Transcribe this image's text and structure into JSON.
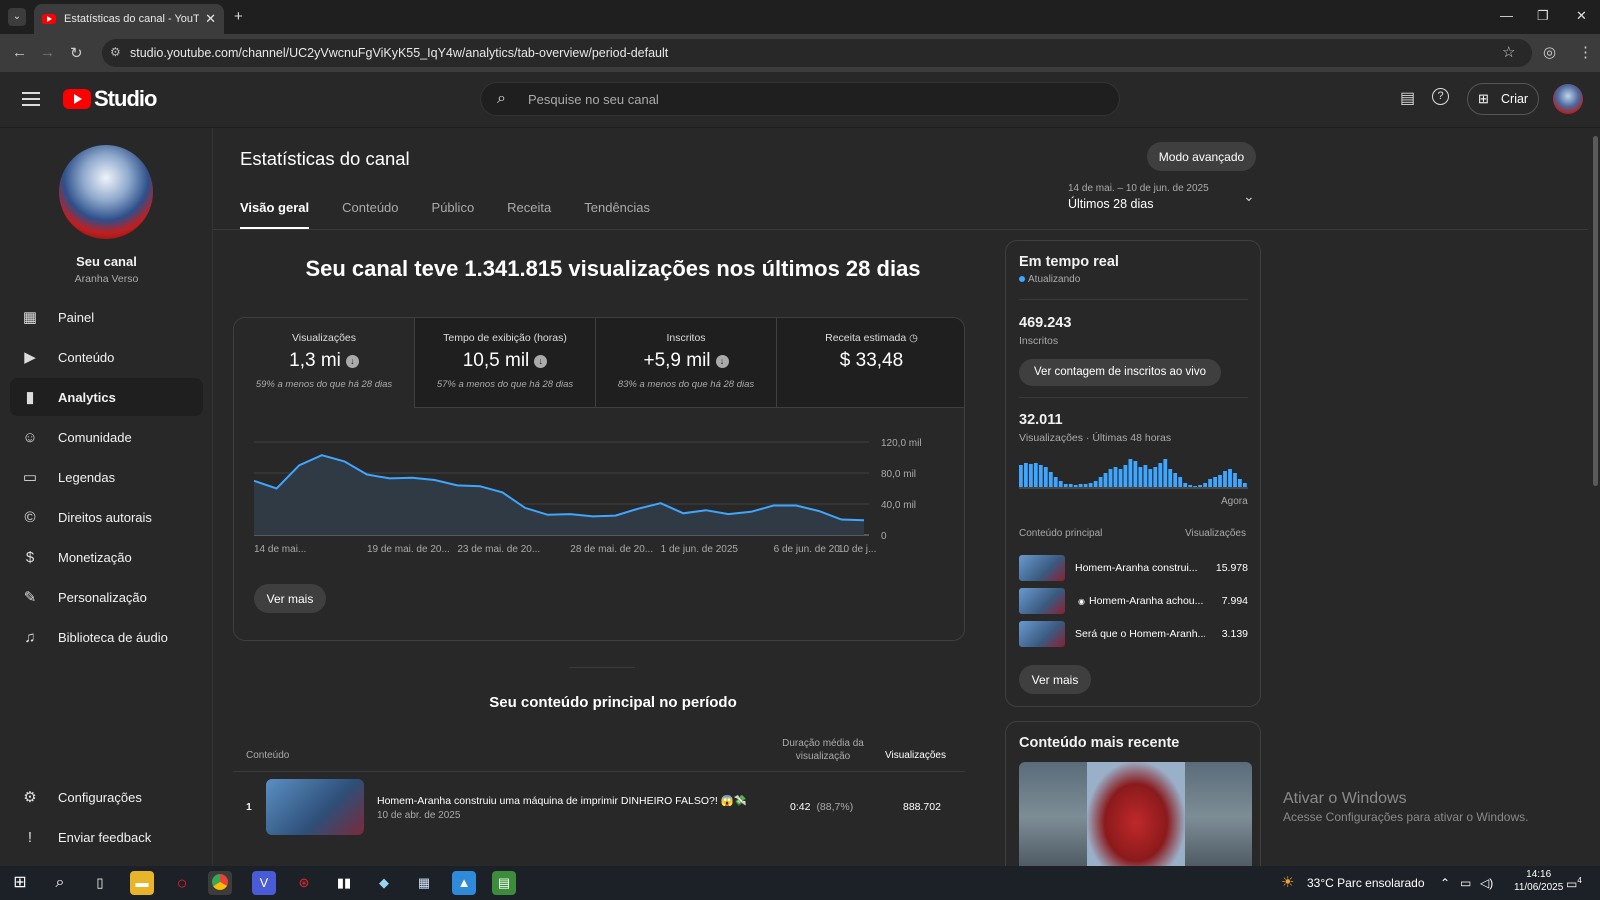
{
  "browser": {
    "tab_title": "Estatísticas do canal - YouTube",
    "url": "studio.youtube.com/channel/UC2yVwcnuFgViKyK55_IqY4w/analytics/tab-overview/period-default"
  },
  "header": {
    "logo_text": "Studio",
    "search_placeholder": "Pesquise no seu canal",
    "create_label": "Criar"
  },
  "sidebar": {
    "channel_title": "Seu canal",
    "channel_name": "Aranha Verso",
    "items": [
      {
        "label": "Painel",
        "icon": "dashboard-icon"
      },
      {
        "label": "Conteúdo",
        "icon": "content-icon"
      },
      {
        "label": "Analytics",
        "icon": "analytics-icon"
      },
      {
        "label": "Comunidade",
        "icon": "community-icon"
      },
      {
        "label": "Legendas",
        "icon": "subtitles-icon"
      },
      {
        "label": "Direitos autorais",
        "icon": "copyright-icon"
      },
      {
        "label": "Monetização",
        "icon": "dollar-icon"
      },
      {
        "label": "Personalização",
        "icon": "magic-wand-icon"
      },
      {
        "label": "Biblioteca de áudio",
        "icon": "audio-library-icon"
      }
    ],
    "settings_label": "Configurações",
    "feedback_label": "Enviar feedback"
  },
  "main": {
    "page_title": "Estatísticas do canal",
    "advanced_mode": "Modo avançado",
    "tabs": [
      "Visão geral",
      "Conteúdo",
      "Público",
      "Receita",
      "Tendências"
    ],
    "date_range": "14 de mai. – 10 de jun. de 2025",
    "date_period": "Últimos 28 dias",
    "headline": "Seu canal teve 1.341.815 visualizações nos últimos 28 dias",
    "metrics": [
      {
        "title": "Visualizações",
        "value": "1,3 mi",
        "sub": "59% a menos do que há 28 dias"
      },
      {
        "title": "Tempo de exibição (horas)",
        "value": "10,5 mil",
        "sub": "57% a menos do que há 28 dias"
      },
      {
        "title": "Inscritos",
        "value": "+5,9 mil",
        "sub": "83% a menos do que há 28 dias"
      },
      {
        "title": "Receita estimada",
        "value": "$ 33,48",
        "sub": ""
      }
    ],
    "see_more": "Ver mais",
    "top_content_title": "Seu conteúdo principal no período",
    "table_headers": {
      "content": "Conteúdo",
      "duration": "Duração média da visualização",
      "views": "Visualizações"
    },
    "rows": [
      {
        "rank": "1",
        "title": "Homem-Aranha construiu uma máquina de imprimir DINHEIRO FALSO?! 😱💸",
        "date": "10 de abr. de 2025",
        "duration": "0:42",
        "duration_pct": "(88,7%)",
        "views": "888.702"
      }
    ]
  },
  "chart_data": {
    "type": "area",
    "x": [
      "14 de mai.",
      "15 de mai.",
      "16 de mai.",
      "17 de mai.",
      "18 de mai.",
      "19 de mai.",
      "20 de mai.",
      "21 de mai.",
      "22 de mai.",
      "23 de mai.",
      "24 de mai.",
      "25 de mai.",
      "26 de mai.",
      "27 de mai.",
      "28 de mai.",
      "29 de mai.",
      "30 de mai.",
      "31 de mai.",
      "1 de jun.",
      "2 de jun.",
      "3 de jun.",
      "4 de jun.",
      "5 de jun.",
      "6 de jun.",
      "7 de jun.",
      "8 de jun.",
      "9 de jun.",
      "10 de jun."
    ],
    "values": [
      70000,
      60000,
      90000,
      103000,
      95000,
      78000,
      73000,
      74000,
      71000,
      64000,
      63000,
      55000,
      35000,
      26000,
      27000,
      24000,
      25000,
      34000,
      41000,
      28000,
      32000,
      27000,
      30000,
      38000,
      38000,
      31000,
      20000,
      19000
    ],
    "x_tick_labels": [
      "14 de mai...",
      "19 de mai. de 20...",
      "23 de mai. de 20...",
      "28 de mai. de 20...",
      "1 de jun. de 2025",
      "6 de jun. de 20...",
      "10 de j..."
    ],
    "y_tick_labels": [
      "120,0 mil",
      "80,0 mil",
      "40,0 mil",
      "0"
    ],
    "ylim": [
      0,
      120000
    ],
    "grid": true
  },
  "realtime": {
    "title": "Em tempo real",
    "status": "Atualizando",
    "subscribers": "469.243",
    "subscribers_label": "Inscritos",
    "live_count_button": "Ver contagem de inscritos ao vivo",
    "views": "32.011",
    "views_label": "Visualizações · Últimas 48 horas",
    "now_label": "Agora",
    "col_content": "Conteúdo principal",
    "col_views": "Visualizações",
    "bars": [
      22,
      24,
      23,
      24,
      22,
      20,
      15,
      10,
      6,
      3,
      3,
      2,
      3,
      3,
      4,
      6,
      10,
      14,
      18,
      20,
      18,
      22,
      28,
      26,
      20,
      22,
      18,
      20,
      24,
      28,
      18,
      14,
      10,
      4,
      2,
      1,
      2,
      4,
      8,
      10,
      12,
      16,
      18,
      14,
      8,
      4
    ],
    "top_videos": [
      {
        "title": "Homem-Aranha construi...",
        "views": "15.978"
      },
      {
        "title": "Homem-Aranha achou...",
        "views": "7.994"
      },
      {
        "title": "Será que o Homem-Aranh...",
        "views": "3.139"
      }
    ],
    "see_more": "Ver mais"
  },
  "recent": {
    "title": "Conteúdo mais recente"
  },
  "watermark": {
    "line1": "Ativar o Windows",
    "line2": "Acesse Configurações para ativar o Windows."
  },
  "taskbar": {
    "weather": "33°C  Parc ensolarado",
    "time": "14:16",
    "date": "11/06/2025",
    "notif_count": "4"
  }
}
